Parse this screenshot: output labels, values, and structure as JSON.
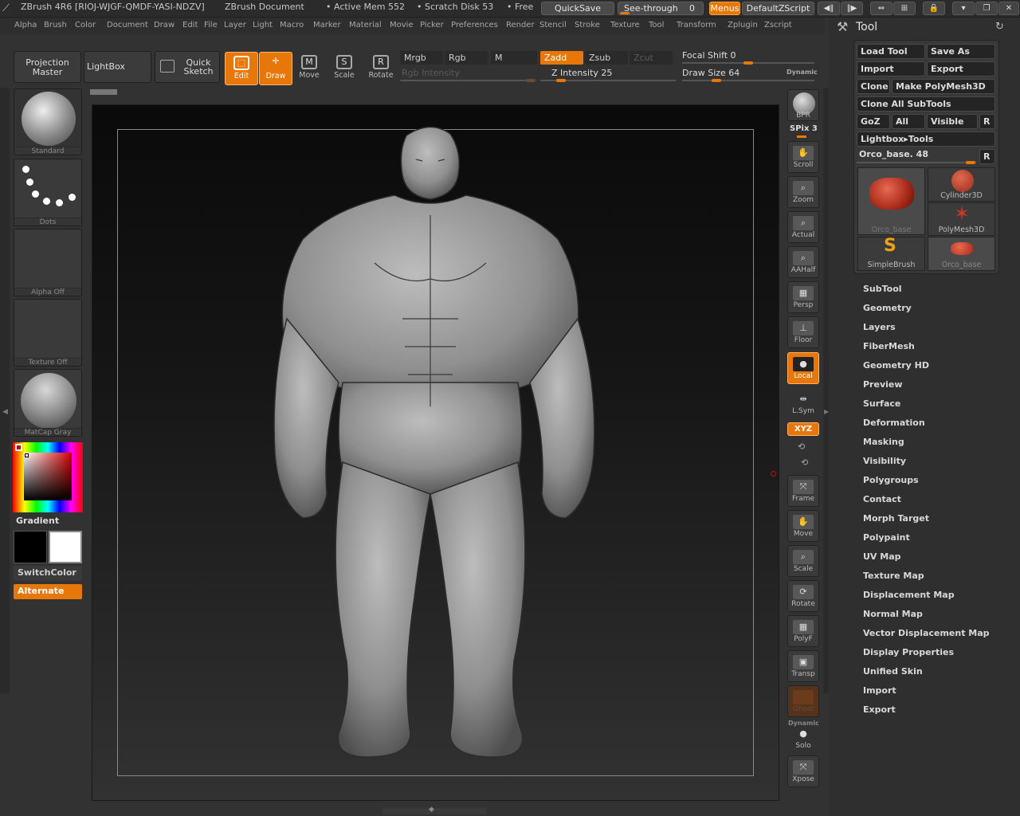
{
  "title": {
    "app": "ZBrush 4R6 [RIOJ-WJGF-QMDF-YASI-NDZV]",
    "document": "ZBrush Document",
    "active_mem": "• Active Mem 552",
    "scratch_disk": "• Scratch Disk 53",
    "free": "• Free",
    "quicksave": "QuickSave",
    "see_through": "See-through",
    "see_through_value": "0",
    "menus": "Menus",
    "default_zscript": "DefaultZScript"
  },
  "menu": [
    "Alpha",
    "Brush",
    "Color",
    "Document",
    "Draw",
    "Edit",
    "File",
    "Layer",
    "Light",
    "Macro",
    "Marker",
    "Material",
    "Movie",
    "Picker",
    "Preferences",
    "Render",
    "Stencil",
    "Stroke",
    "Texture",
    "Tool",
    "Transform",
    "Zplugin",
    "Zscript"
  ],
  "toolbar": {
    "projection_master": "Projection Master",
    "lightbox": "LightBox",
    "quick_sketch": "Quick Sketch",
    "edit": "Edit",
    "draw": "Draw",
    "move": "Move",
    "scale": "Scale",
    "rotate": "Rotate",
    "mrgb": "Mrgb",
    "rgb": "Rgb",
    "m": "M",
    "zadd": "Zadd",
    "zsub": "Zsub",
    "zcut": "Zcut",
    "rgb_intensity": "Rgb Intensity",
    "z_intensity": "Z Intensity 25",
    "focal_shift": "Focal Shift 0",
    "draw_size": "Draw Size 64",
    "dynamic": "Dynamic"
  },
  "levels": {
    "z_intensity": 0.25,
    "focal_shift": 0.5,
    "draw_size": 0.1
  },
  "left_shelf": {
    "brush": "Standard",
    "stroke": "Dots",
    "alpha": "Alpha Off",
    "texture": "Texture Off",
    "material": "MatCap Gray",
    "gradient": "Gradient",
    "switch_color": "SwitchColor",
    "alternate": "Alternate"
  },
  "right_shelf": {
    "bpr": "BPR",
    "spix": "SPix 3",
    "scroll": "Scroll",
    "zoom": "Zoom",
    "actual": "Actual",
    "aahalf": "AAHalf",
    "persp": "Persp",
    "floor": "Floor",
    "local": "Local",
    "lsym": "L.Sym",
    "xyz": "XYZ",
    "frame": "Frame",
    "move": "Move",
    "scale": "Scale",
    "rotate": "Rotate",
    "polyf": "PolyF",
    "transp": "Transp",
    "ghost": "Ghost",
    "dynamic": "Dynamic",
    "solo": "Solo",
    "xpose": "Xpose"
  },
  "tool_panel": {
    "title": "Tool",
    "load_tool": "Load Tool",
    "save_as": "Save As",
    "import": "Import",
    "export": "Export",
    "clone": "Clone",
    "make_polymesh": "Make PolyMesh3D",
    "clone_all": "Clone All SubTools",
    "goz": "GoZ",
    "all": "All",
    "visible": "Visible",
    "r": "R",
    "lightbox_tools": "Lightbox▸Tools",
    "current_tool": "Orco_base. 48",
    "thumbs": {
      "orco_big": "Orco_base",
      "cylinder": "Cylinder3D",
      "polymesh": "PolyMesh3D",
      "simplebrush": "SimpleBrush",
      "orco_small": "Orco_base"
    },
    "sections": [
      "SubTool",
      "Geometry",
      "Layers",
      "FiberMesh",
      "Geometry HD",
      "Preview",
      "Surface",
      "Deformation",
      "Masking",
      "Visibility",
      "Polygroups",
      "Contact",
      "Morph Target",
      "Polypaint",
      "UV Map",
      "Texture Map",
      "Displacement Map",
      "Normal Map",
      "Vector Displacement Map",
      "Display Properties",
      "Unified Skin",
      "Import",
      "Export"
    ]
  },
  "colors": {
    "accent": "#e8770a",
    "panel": "#2f2f2f",
    "viewport": "#1a1a1a"
  }
}
